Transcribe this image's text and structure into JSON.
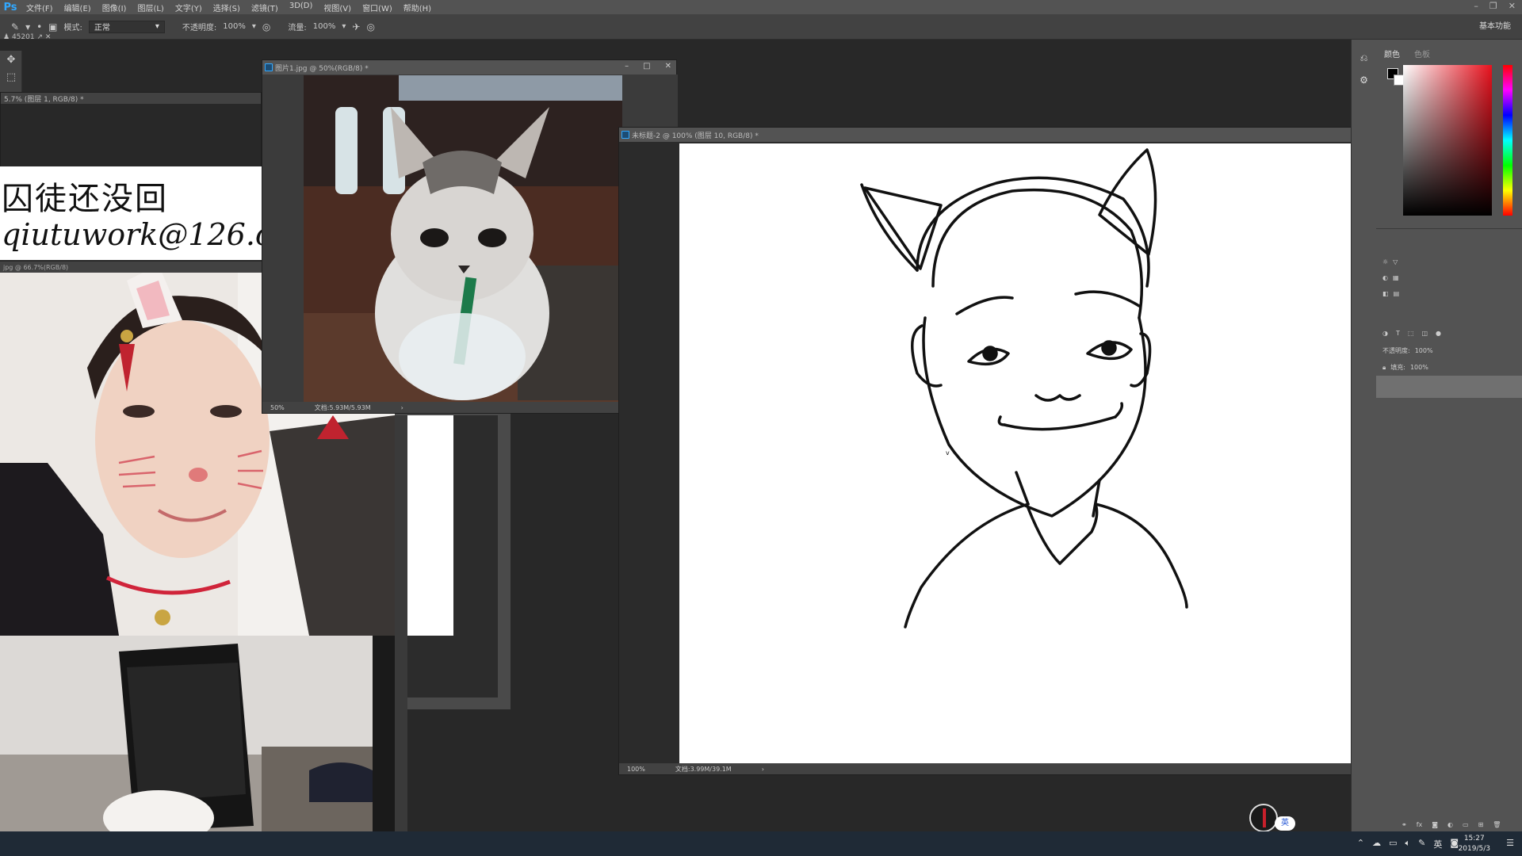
{
  "app": {
    "logo": "Ps"
  },
  "menu": [
    "文件(F)",
    "编辑(E)",
    "图像(I)",
    "图层(L)",
    "文字(Y)",
    "选择(S)",
    "滤镜(T)",
    "3D(D)",
    "视图(V)",
    "窗口(W)",
    "帮助(H)"
  ],
  "options": {
    "mode_label": "模式:",
    "mode_value": "正常",
    "opacity_label": "不透明度:",
    "opacity_value": "100%",
    "flow_label": "流量:",
    "flow_value": "100%",
    "workspace": "基本功能"
  },
  "history_label": "45201",
  "doc_behind": {
    "title": "5.7% (图层 1, RGB/8) *"
  },
  "doc_photo": {
    "title": "jpg @ 66.7%(RGB/8)"
  },
  "handwriting": {
    "line1": "囚徒还没回",
    "line2": "qiutuwork@126.c"
  },
  "doc_cat": {
    "title": "图片1.jpg @ 50%(RGB/8) *",
    "zoom": "50%",
    "docsize": "文档:5.93M/5.93M"
  },
  "doc_main": {
    "title": "未标题-2 @ 100% (图层 10, RGB/8) *",
    "zoom": "100%",
    "docsize": "文档:3.99M/39.1M"
  },
  "panels": {
    "color_tab": "颜色",
    "swatch_tab": "色板",
    "opacity_label": "不透明度:",
    "opacity_value": "100%",
    "fill_label": "填充:",
    "fill_value": "100%"
  },
  "taskbar": {
    "ime": "英",
    "lang": "英",
    "time": "15:27",
    "date": "2019/5/3"
  },
  "colors": {
    "menubar": "#535353",
    "optionsbar": "#424242",
    "workspace_bg": "#282828",
    "panel_bg": "#535353",
    "accent": "#31a8ff"
  }
}
